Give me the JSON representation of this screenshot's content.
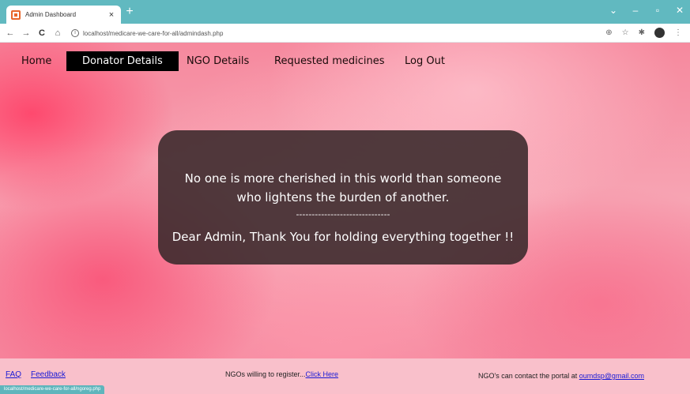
{
  "browser": {
    "tab_title": "Admin Dashboard",
    "tab_close": "×",
    "new_tab": "+",
    "url": "localhost/medicare-we-care-for-all/admindash.php",
    "status_url": "localhost/medicare-we-care-for-all/ngoreg.php",
    "window_controls": {
      "chevron": "⌄",
      "minimize": "–",
      "maximize": "▫",
      "close": "✕"
    }
  },
  "nav": {
    "home": "Home",
    "donator_details": "Donator Details",
    "ngo_details": "NGO Details",
    "requested_medicines": "Requested medicines",
    "log_out": "Log Out"
  },
  "quote": {
    "line1": "No one is more cherished in this world than someone",
    "line2": "who lightens the burden of another.",
    "divider": "------------------------------",
    "line3": "Dear Admin, Thank You for holding everything together !!"
  },
  "footer": {
    "faq": "FAQ",
    "feedback": "Feedback",
    "register_text": "NGOs willing to register...",
    "register_link": "Click Here",
    "contact_text": "NGO's can contact the portal at ",
    "contact_email": "oumdsp@gmail.com"
  },
  "colors": {
    "tabbar": "#61b9c0",
    "active_nav_bg": "#000000",
    "quote_bg": "#38282a",
    "footer_bg": "#f9c0cb",
    "link": "#1a1ad6"
  },
  "icons": [
    "back-arrow-icon",
    "forward-arrow-icon",
    "reload-icon",
    "home-icon",
    "info-icon",
    "share-icon",
    "star-icon",
    "extensions-icon",
    "profile-icon",
    "menu-icon"
  ]
}
